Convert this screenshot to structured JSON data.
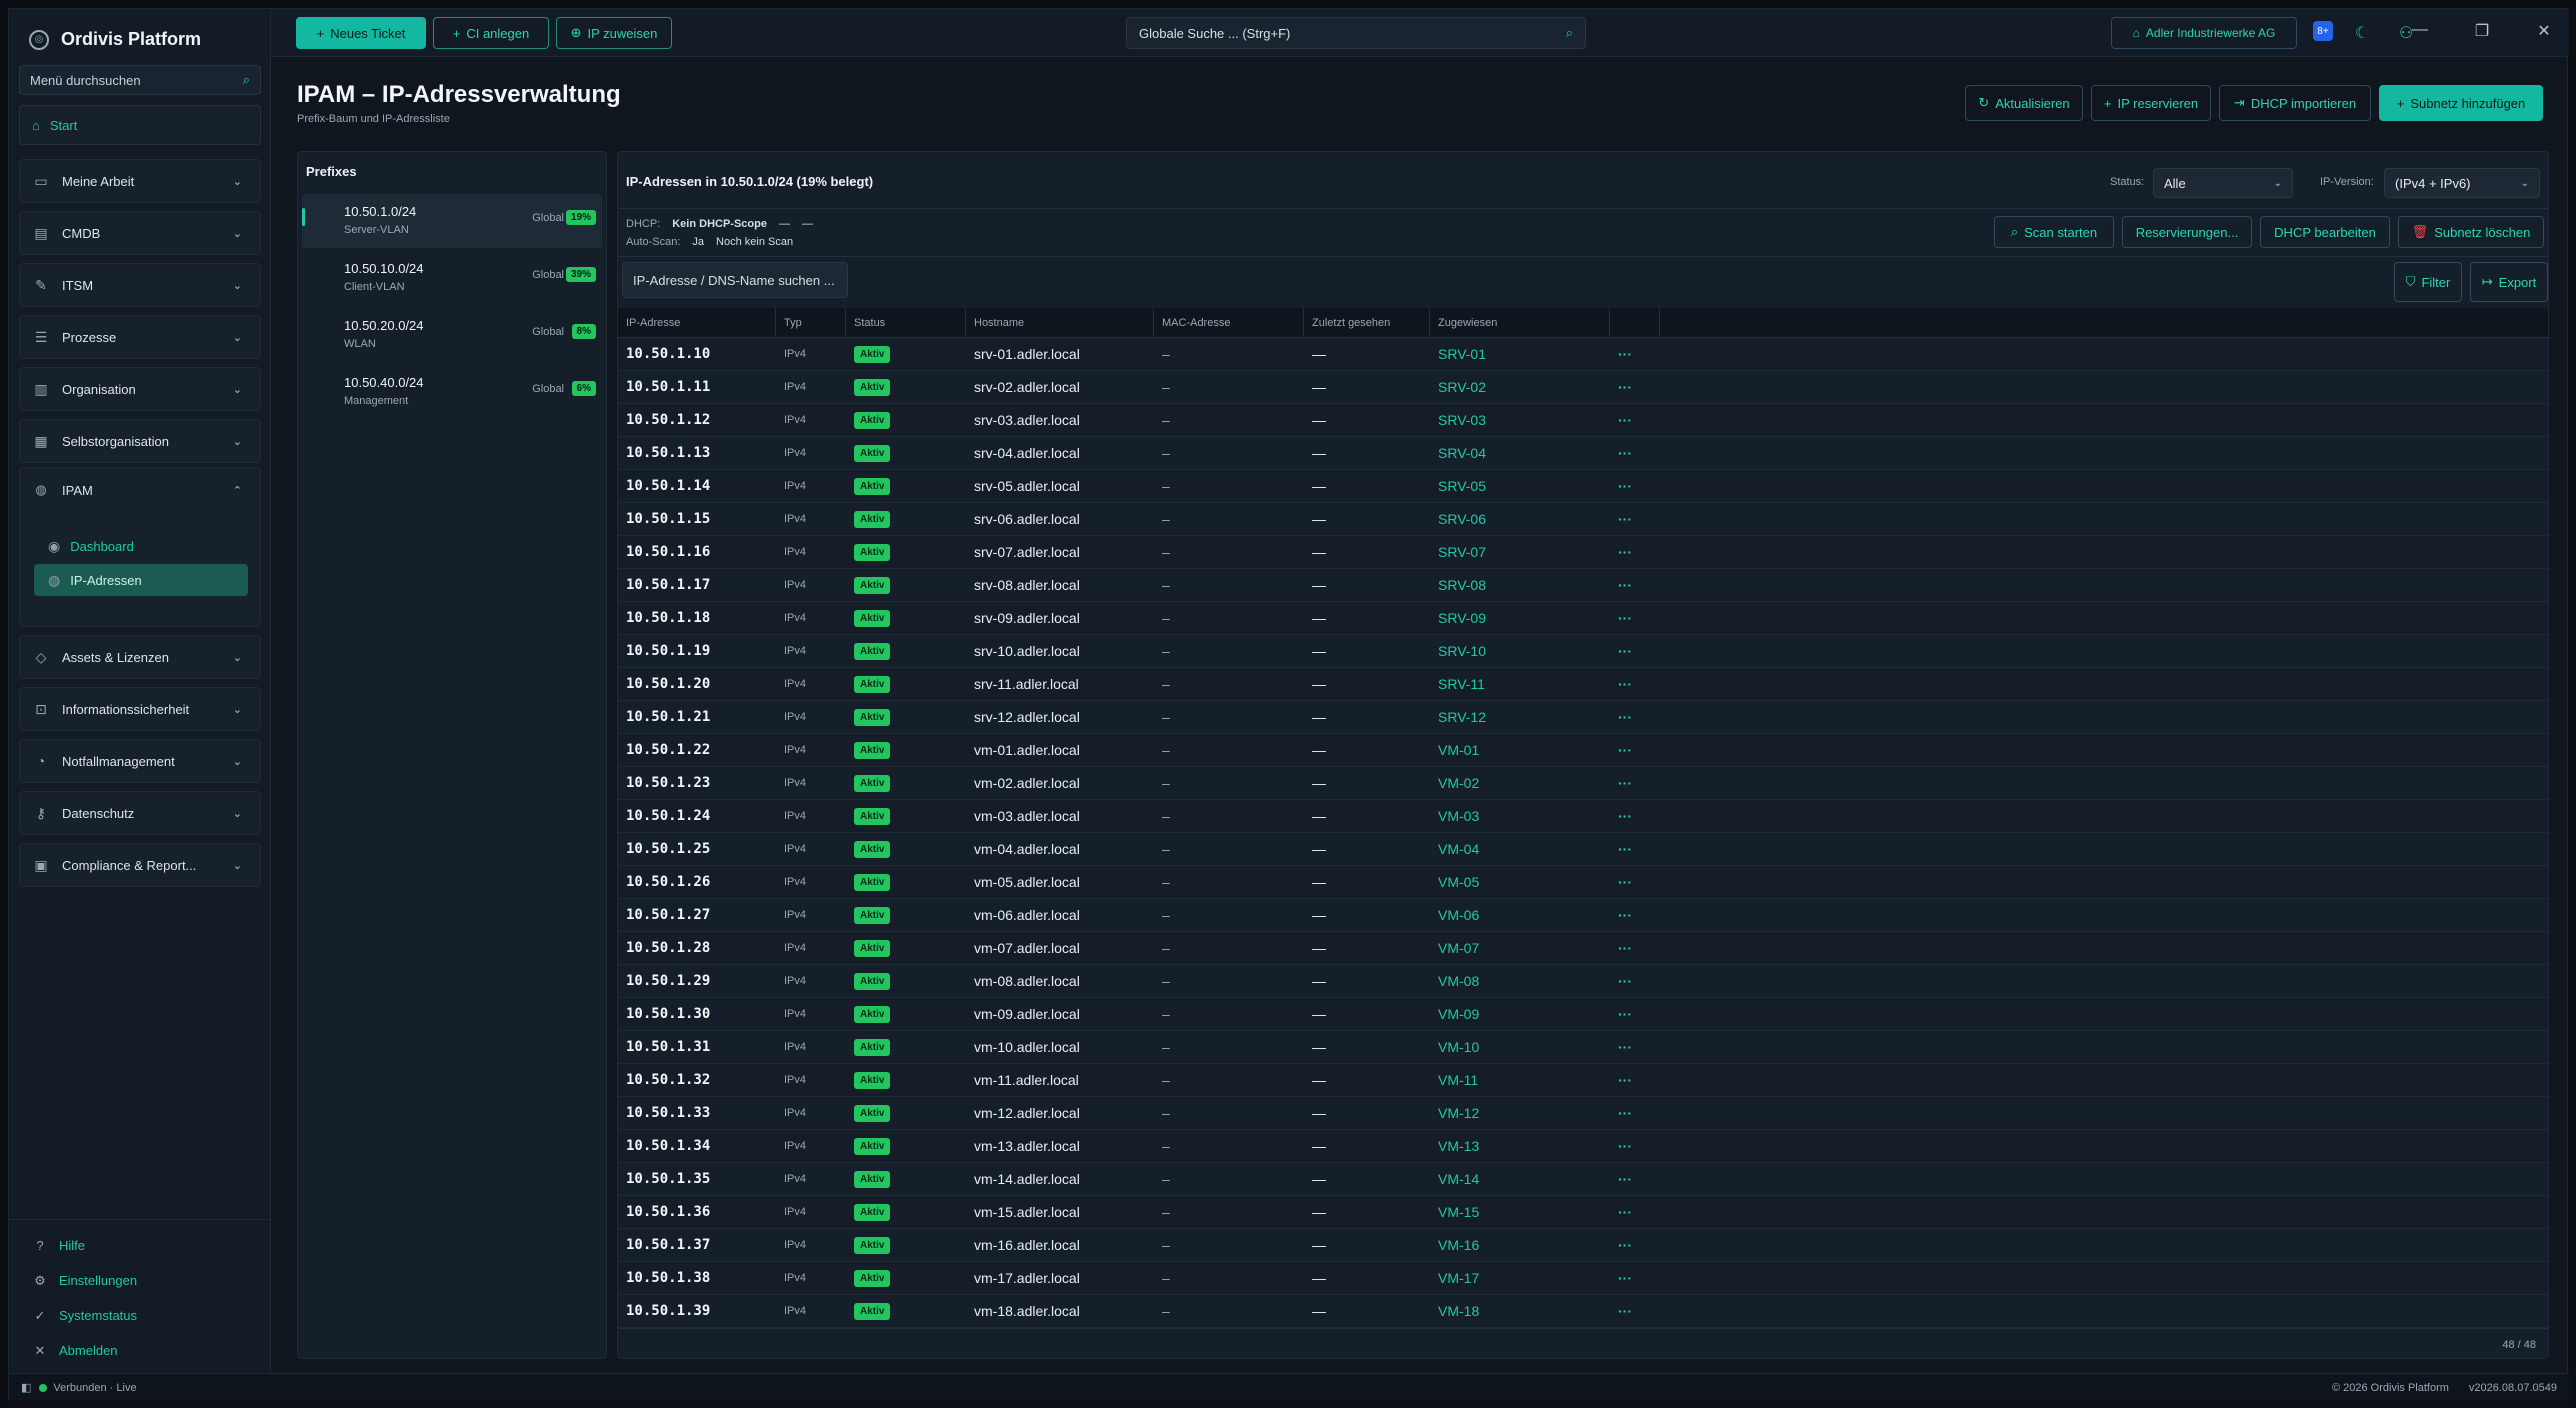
{
  "app": {
    "title": "Ordivis Platform"
  },
  "window": {
    "minimize": "—",
    "restore": "❐",
    "close": "✕"
  },
  "sidebar": {
    "search_placeholder": "Menü durchsuchen",
    "start": "Start",
    "items": [
      {
        "label": "Meine Arbeit",
        "icon": "briefcase-icon"
      },
      {
        "label": "CMDB",
        "icon": "database-icon"
      },
      {
        "label": "ITSM",
        "icon": "wrench-icon"
      },
      {
        "label": "Prozesse",
        "icon": "list-icon"
      },
      {
        "label": "Organisation",
        "icon": "building-icon"
      },
      {
        "label": "Selbstorganisation",
        "icon": "calendar-icon"
      },
      {
        "label": "IPAM",
        "icon": "network-icon"
      },
      {
        "label": "Assets & Lizenzen",
        "icon": "tag-icon"
      },
      {
        "label": "Informationssicherheit",
        "icon": "lock-icon"
      },
      {
        "label": "Notfallmanagement",
        "icon": "bell-icon"
      },
      {
        "label": "Datenschutz",
        "icon": "key-icon"
      },
      {
        "label": "Compliance & Report...",
        "icon": "report-icon"
      }
    ],
    "ipam_sub": [
      {
        "label": "Dashboard"
      },
      {
        "label": "IP-Adressen"
      }
    ],
    "bottom": [
      {
        "label": "Hilfe",
        "icon": "?"
      },
      {
        "label": "Einstellungen",
        "icon": "⚙"
      },
      {
        "label": "Systemstatus",
        "icon": "✓"
      },
      {
        "label": "Abmelden",
        "icon": "✕"
      }
    ]
  },
  "topbar": {
    "new_ticket": "Neues Ticket",
    "create_ci": "CI anlegen",
    "assign_ip": "IP zuweisen",
    "search_placeholder": "Globale Suche ... (Strg+F)",
    "org": "Adler Industriewerke AG",
    "badge": "8+"
  },
  "page": {
    "title": "IPAM – IP-Adressverwaltung",
    "subtitle": "Prefix-Baum und IP-Adressliste",
    "actions": {
      "refresh": "Aktualisieren",
      "reserve": "IP reservieren",
      "dhcp_import": "DHCP importieren",
      "add_subnet": "Subnetz hinzufügen"
    }
  },
  "prefixes": {
    "title": "Prefixes",
    "items": [
      {
        "cidr": "10.50.1.0/24",
        "vlan": "Server-VLAN",
        "scope": "Global",
        "pct": "19%"
      },
      {
        "cidr": "10.50.10.0/24",
        "vlan": "Client-VLAN",
        "scope": "Global",
        "pct": "39%"
      },
      {
        "cidr": "10.50.20.0/24",
        "vlan": "WLAN",
        "scope": "Global",
        "pct": "8%"
      },
      {
        "cidr": "10.50.40.0/24",
        "vlan": "Management",
        "scope": "Global",
        "pct": "6%"
      }
    ]
  },
  "main": {
    "title": "IP-Adressen in 10.50.1.0/24  (19% belegt)",
    "status_label": "Status:",
    "status_value": "Alle",
    "version_label": "IP-Version:",
    "version_value": "(IPv4 + IPv6)",
    "dhcp_label": "DHCP:",
    "dhcp_value": "Kein DHCP-Scope",
    "dhcp_extra1": "—",
    "dhcp_extra2": "—",
    "autoscan_label": "Auto-Scan:",
    "autoscan_value": "Ja",
    "autoscan_extra": "Noch kein Scan",
    "btn_scan": "Scan starten",
    "btn_reservations": "Reservierungen...",
    "btn_dhcp_edit": "DHCP bearbeiten",
    "btn_delete_subnet": "Subnetz löschen",
    "search_placeholder": "IP-Adresse / DNS-Name suchen ...",
    "btn_filter": "Filter",
    "btn_export": "Export",
    "columns": [
      "IP-Adresse",
      "Typ",
      "Status",
      "Hostname",
      "MAC-Adresse",
      "Zuletzt gesehen",
      "Zugewiesen"
    ],
    "rows": [
      {
        "ip": "10.50.1.10",
        "typ": "IPv4",
        "status": "Aktiv",
        "host": "srv-01.adler.local",
        "mac": "–",
        "seen": "—",
        "assigned": "SRV-01",
        "act": "···"
      },
      {
        "ip": "10.50.1.11",
        "typ": "IPv4",
        "status": "Aktiv",
        "host": "srv-02.adler.local",
        "mac": "–",
        "seen": "—",
        "assigned": "SRV-02",
        "act": "···"
      },
      {
        "ip": "10.50.1.12",
        "typ": "IPv4",
        "status": "Aktiv",
        "host": "srv-03.adler.local",
        "mac": "–",
        "seen": "—",
        "assigned": "SRV-03",
        "act": "···"
      },
      {
        "ip": "10.50.1.13",
        "typ": "IPv4",
        "status": "Aktiv",
        "host": "srv-04.adler.local",
        "mac": "–",
        "seen": "—",
        "assigned": "SRV-04",
        "act": "···"
      },
      {
        "ip": "10.50.1.14",
        "typ": "IPv4",
        "status": "Aktiv",
        "host": "srv-05.adler.local",
        "mac": "–",
        "seen": "—",
        "assigned": "SRV-05",
        "act": "···"
      },
      {
        "ip": "10.50.1.15",
        "typ": "IPv4",
        "status": "Aktiv",
        "host": "srv-06.adler.local",
        "mac": "–",
        "seen": "—",
        "assigned": "SRV-06",
        "act": "···"
      },
      {
        "ip": "10.50.1.16",
        "typ": "IPv4",
        "status": "Aktiv",
        "host": "srv-07.adler.local",
        "mac": "–",
        "seen": "—",
        "assigned": "SRV-07",
        "act": "···"
      },
      {
        "ip": "10.50.1.17",
        "typ": "IPv4",
        "status": "Aktiv",
        "host": "srv-08.adler.local",
        "mac": "–",
        "seen": "—",
        "assigned": "SRV-08",
        "act": "···"
      },
      {
        "ip": "10.50.1.18",
        "typ": "IPv4",
        "status": "Aktiv",
        "host": "srv-09.adler.local",
        "mac": "–",
        "seen": "—",
        "assigned": "SRV-09",
        "act": "···"
      },
      {
        "ip": "10.50.1.19",
        "typ": "IPv4",
        "status": "Aktiv",
        "host": "srv-10.adler.local",
        "mac": "–",
        "seen": "—",
        "assigned": "SRV-10",
        "act": "···"
      },
      {
        "ip": "10.50.1.20",
        "typ": "IPv4",
        "status": "Aktiv",
        "host": "srv-11.adler.local",
        "mac": "–",
        "seen": "—",
        "assigned": "SRV-11",
        "act": "···"
      },
      {
        "ip": "10.50.1.21",
        "typ": "IPv4",
        "status": "Aktiv",
        "host": "srv-12.adler.local",
        "mac": "–",
        "seen": "—",
        "assigned": "SRV-12",
        "act": "···"
      },
      {
        "ip": "10.50.1.22",
        "typ": "IPv4",
        "status": "Aktiv",
        "host": "vm-01.adler.local",
        "mac": "–",
        "seen": "—",
        "assigned": "VM-01",
        "act": "···"
      },
      {
        "ip": "10.50.1.23",
        "typ": "IPv4",
        "status": "Aktiv",
        "host": "vm-02.adler.local",
        "mac": "–",
        "seen": "—",
        "assigned": "VM-02",
        "act": "···"
      },
      {
        "ip": "10.50.1.24",
        "typ": "IPv4",
        "status": "Aktiv",
        "host": "vm-03.adler.local",
        "mac": "–",
        "seen": "—",
        "assigned": "VM-03",
        "act": "···"
      },
      {
        "ip": "10.50.1.25",
        "typ": "IPv4",
        "status": "Aktiv",
        "host": "vm-04.adler.local",
        "mac": "–",
        "seen": "—",
        "assigned": "VM-04",
        "act": "···"
      },
      {
        "ip": "10.50.1.26",
        "typ": "IPv4",
        "status": "Aktiv",
        "host": "vm-05.adler.local",
        "mac": "–",
        "seen": "—",
        "assigned": "VM-05",
        "act": "···"
      },
      {
        "ip": "10.50.1.27",
        "typ": "IPv4",
        "status": "Aktiv",
        "host": "vm-06.adler.local",
        "mac": "–",
        "seen": "—",
        "assigned": "VM-06",
        "act": "···"
      },
      {
        "ip": "10.50.1.28",
        "typ": "IPv4",
        "status": "Aktiv",
        "host": "vm-07.adler.local",
        "mac": "–",
        "seen": "—",
        "assigned": "VM-07",
        "act": "···"
      },
      {
        "ip": "10.50.1.29",
        "typ": "IPv4",
        "status": "Aktiv",
        "host": "vm-08.adler.local",
        "mac": "–",
        "seen": "—",
        "assigned": "VM-08",
        "act": "···"
      },
      {
        "ip": "10.50.1.30",
        "typ": "IPv4",
        "status": "Aktiv",
        "host": "vm-09.adler.local",
        "mac": "–",
        "seen": "—",
        "assigned": "VM-09",
        "act": "···"
      },
      {
        "ip": "10.50.1.31",
        "typ": "IPv4",
        "status": "Aktiv",
        "host": "vm-10.adler.local",
        "mac": "–",
        "seen": "—",
        "assigned": "VM-10",
        "act": "···"
      },
      {
        "ip": "10.50.1.32",
        "typ": "IPv4",
        "status": "Aktiv",
        "host": "vm-11.adler.local",
        "mac": "–",
        "seen": "—",
        "assigned": "VM-11",
        "act": "···"
      },
      {
        "ip": "10.50.1.33",
        "typ": "IPv4",
        "status": "Aktiv",
        "host": "vm-12.adler.local",
        "mac": "–",
        "seen": "—",
        "assigned": "VM-12",
        "act": "···"
      },
      {
        "ip": "10.50.1.34",
        "typ": "IPv4",
        "status": "Aktiv",
        "host": "vm-13.adler.local",
        "mac": "–",
        "seen": "—",
        "assigned": "VM-13",
        "act": "···"
      },
      {
        "ip": "10.50.1.35",
        "typ": "IPv4",
        "status": "Aktiv",
        "host": "vm-14.adler.local",
        "mac": "–",
        "seen": "—",
        "assigned": "VM-14",
        "act": "···"
      },
      {
        "ip": "10.50.1.36",
        "typ": "IPv4",
        "status": "Aktiv",
        "host": "vm-15.adler.local",
        "mac": "–",
        "seen": "—",
        "assigned": "VM-15",
        "act": "···"
      },
      {
        "ip": "10.50.1.37",
        "typ": "IPv4",
        "status": "Aktiv",
        "host": "vm-16.adler.local",
        "mac": "–",
        "seen": "—",
        "assigned": "VM-16",
        "act": "···"
      },
      {
        "ip": "10.50.1.38",
        "typ": "IPv4",
        "status": "Aktiv",
        "host": "vm-17.adler.local",
        "mac": "–",
        "seen": "—",
        "assigned": "VM-17",
        "act": "···"
      },
      {
        "ip": "10.50.1.39",
        "typ": "IPv4",
        "status": "Aktiv",
        "host": "vm-18.adler.local",
        "mac": "–",
        "seen": "—",
        "assigned": "VM-18",
        "act": "···"
      }
    ],
    "count": "48 / 48"
  },
  "statusbar": {
    "connection": "Verbunden · Live",
    "copyright": "© 2026 Ordivis Platform",
    "version": "v2026.08.07.0549"
  },
  "colors": {
    "accent": "#22c9a6",
    "primary": "#14b8a0",
    "active_badge": "#22c55e",
    "danger": "#ef4444"
  }
}
